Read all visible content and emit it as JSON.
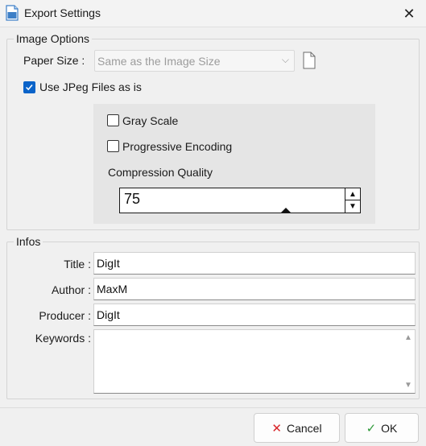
{
  "window": {
    "title": "Export Settings",
    "close_glyph": "✕",
    "icon": "document-export-icon"
  },
  "image_options": {
    "legend": "Image Options",
    "paper_size_label": "Paper Size :",
    "paper_size_value": "Same as the Image Size",
    "paper_size_disabled": true,
    "use_jpeg_label": "Use JPeg Files as is",
    "use_jpeg_checked": true,
    "gray_scale_label": "Gray Scale",
    "gray_scale_checked": false,
    "progressive_label": "Progressive Encoding",
    "progressive_checked": false,
    "compression_label": "Compression Quality",
    "compression_value": "75"
  },
  "infos": {
    "legend": "Infos",
    "title_label": "Title :",
    "title_value": "DigIt",
    "author_label": "Author :",
    "author_value": "MaxM",
    "producer_label": "Producer :",
    "producer_value": "DigIt",
    "keywords_label": "Keywords :",
    "keywords_value": ""
  },
  "buttons": {
    "cancel_label": "Cancel",
    "cancel_icon_glyph": "✕",
    "ok_label": "OK",
    "ok_icon_glyph": "✓"
  },
  "colors": {
    "accent": "#0a63c9",
    "cancel_icon": "#d9262a",
    "ok_icon": "#2f9a3a"
  }
}
